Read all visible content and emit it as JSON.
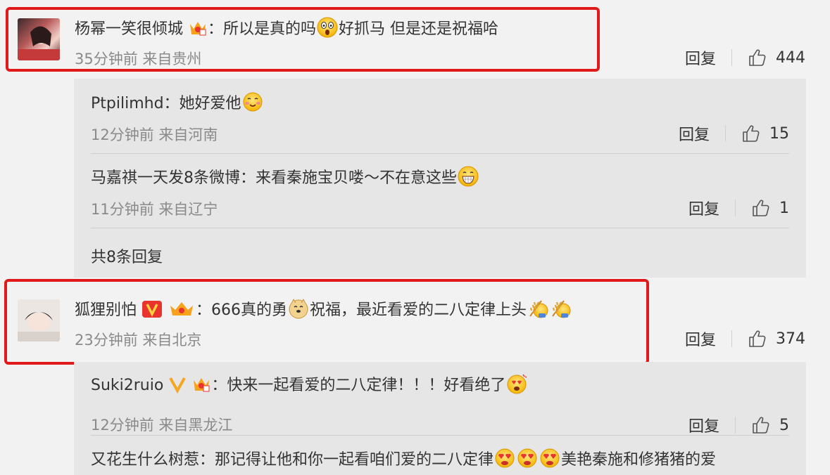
{
  "comments": [
    {
      "user": "杨幂一笑很倾城",
      "text_a": "：所以是真的吗",
      "text_b": "好抓马 但是还是祝福哈",
      "meta": "35分钟前 来自贵州",
      "reply_label": "回复",
      "likes": "444"
    },
    {
      "user": "狐狸别怕",
      "text_a": "：666真的勇",
      "text_b": "祝福，最近看爱的二八定律上头",
      "meta": "23分钟前 来自北京",
      "reply_label": "回复",
      "likes": "374"
    }
  ],
  "replies_1": [
    {
      "user": "Ptpilimhd",
      "text": "：她好爱他",
      "meta": "12分钟前 来自河南",
      "reply_label": "回复",
      "likes": "15"
    },
    {
      "user": "马嘉祺一天发8条微博",
      "text": "：来看秦施宝贝喽～不在意这些",
      "meta": "11分钟前 来自辽宁",
      "reply_label": "回复",
      "likes": "1"
    }
  ],
  "replies_1_total": "共8条回复",
  "replies_2": [
    {
      "user": "Suki2ruio",
      "text": "：快来一起看爱的二八定律！！！好看绝了",
      "meta": "12分钟前 来自黑龙江",
      "reply_label": "回复",
      "likes": "5"
    },
    {
      "user": "又花生什么树惹",
      "text": "：那记得让他和你一起看咱们爱的二八定律",
      "text_b": "美艳秦施和修猪猪的爱"
    }
  ],
  "colors": {
    "highlight": "#e01a1a",
    "meta": "#8a8a8a",
    "panel": "#e6e6e6",
    "bg": "#f2f2f2"
  }
}
